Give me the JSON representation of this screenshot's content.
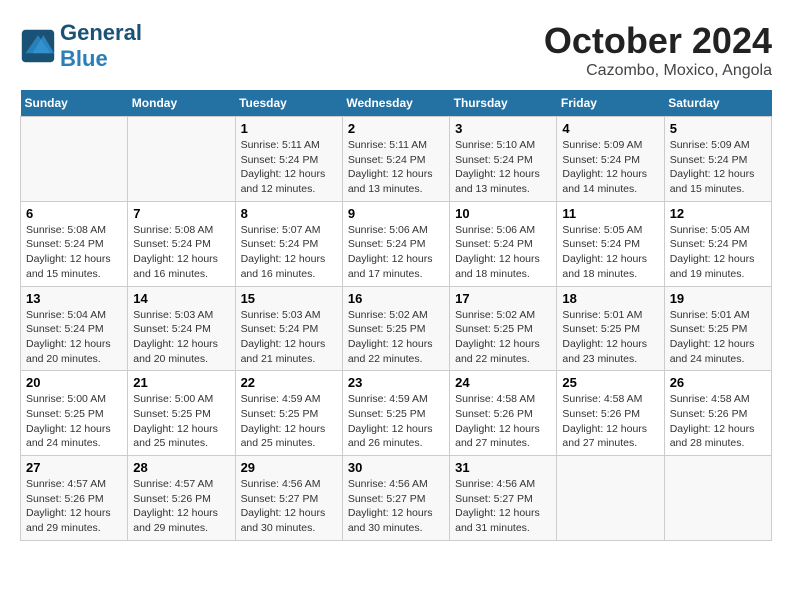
{
  "logo": {
    "general": "General",
    "blue": "Blue"
  },
  "title": "October 2024",
  "subtitle": "Cazombo, Moxico, Angola",
  "days_header": [
    "Sunday",
    "Monday",
    "Tuesday",
    "Wednesday",
    "Thursday",
    "Friday",
    "Saturday"
  ],
  "weeks": [
    [
      {
        "day": "",
        "info": ""
      },
      {
        "day": "",
        "info": ""
      },
      {
        "day": "1",
        "info": "Sunrise: 5:11 AM\nSunset: 5:24 PM\nDaylight: 12 hours\nand 12 minutes."
      },
      {
        "day": "2",
        "info": "Sunrise: 5:11 AM\nSunset: 5:24 PM\nDaylight: 12 hours\nand 13 minutes."
      },
      {
        "day": "3",
        "info": "Sunrise: 5:10 AM\nSunset: 5:24 PM\nDaylight: 12 hours\nand 13 minutes."
      },
      {
        "day": "4",
        "info": "Sunrise: 5:09 AM\nSunset: 5:24 PM\nDaylight: 12 hours\nand 14 minutes."
      },
      {
        "day": "5",
        "info": "Sunrise: 5:09 AM\nSunset: 5:24 PM\nDaylight: 12 hours\nand 15 minutes."
      }
    ],
    [
      {
        "day": "6",
        "info": "Sunrise: 5:08 AM\nSunset: 5:24 PM\nDaylight: 12 hours\nand 15 minutes."
      },
      {
        "day": "7",
        "info": "Sunrise: 5:08 AM\nSunset: 5:24 PM\nDaylight: 12 hours\nand 16 minutes."
      },
      {
        "day": "8",
        "info": "Sunrise: 5:07 AM\nSunset: 5:24 PM\nDaylight: 12 hours\nand 16 minutes."
      },
      {
        "day": "9",
        "info": "Sunrise: 5:06 AM\nSunset: 5:24 PM\nDaylight: 12 hours\nand 17 minutes."
      },
      {
        "day": "10",
        "info": "Sunrise: 5:06 AM\nSunset: 5:24 PM\nDaylight: 12 hours\nand 18 minutes."
      },
      {
        "day": "11",
        "info": "Sunrise: 5:05 AM\nSunset: 5:24 PM\nDaylight: 12 hours\nand 18 minutes."
      },
      {
        "day": "12",
        "info": "Sunrise: 5:05 AM\nSunset: 5:24 PM\nDaylight: 12 hours\nand 19 minutes."
      }
    ],
    [
      {
        "day": "13",
        "info": "Sunrise: 5:04 AM\nSunset: 5:24 PM\nDaylight: 12 hours\nand 20 minutes."
      },
      {
        "day": "14",
        "info": "Sunrise: 5:03 AM\nSunset: 5:24 PM\nDaylight: 12 hours\nand 20 minutes."
      },
      {
        "day": "15",
        "info": "Sunrise: 5:03 AM\nSunset: 5:24 PM\nDaylight: 12 hours\nand 21 minutes."
      },
      {
        "day": "16",
        "info": "Sunrise: 5:02 AM\nSunset: 5:25 PM\nDaylight: 12 hours\nand 22 minutes."
      },
      {
        "day": "17",
        "info": "Sunrise: 5:02 AM\nSunset: 5:25 PM\nDaylight: 12 hours\nand 22 minutes."
      },
      {
        "day": "18",
        "info": "Sunrise: 5:01 AM\nSunset: 5:25 PM\nDaylight: 12 hours\nand 23 minutes."
      },
      {
        "day": "19",
        "info": "Sunrise: 5:01 AM\nSunset: 5:25 PM\nDaylight: 12 hours\nand 24 minutes."
      }
    ],
    [
      {
        "day": "20",
        "info": "Sunrise: 5:00 AM\nSunset: 5:25 PM\nDaylight: 12 hours\nand 24 minutes."
      },
      {
        "day": "21",
        "info": "Sunrise: 5:00 AM\nSunset: 5:25 PM\nDaylight: 12 hours\nand 25 minutes."
      },
      {
        "day": "22",
        "info": "Sunrise: 4:59 AM\nSunset: 5:25 PM\nDaylight: 12 hours\nand 25 minutes."
      },
      {
        "day": "23",
        "info": "Sunrise: 4:59 AM\nSunset: 5:25 PM\nDaylight: 12 hours\nand 26 minutes."
      },
      {
        "day": "24",
        "info": "Sunrise: 4:58 AM\nSunset: 5:26 PM\nDaylight: 12 hours\nand 27 minutes."
      },
      {
        "day": "25",
        "info": "Sunrise: 4:58 AM\nSunset: 5:26 PM\nDaylight: 12 hours\nand 27 minutes."
      },
      {
        "day": "26",
        "info": "Sunrise: 4:58 AM\nSunset: 5:26 PM\nDaylight: 12 hours\nand 28 minutes."
      }
    ],
    [
      {
        "day": "27",
        "info": "Sunrise: 4:57 AM\nSunset: 5:26 PM\nDaylight: 12 hours\nand 29 minutes."
      },
      {
        "day": "28",
        "info": "Sunrise: 4:57 AM\nSunset: 5:26 PM\nDaylight: 12 hours\nand 29 minutes."
      },
      {
        "day": "29",
        "info": "Sunrise: 4:56 AM\nSunset: 5:27 PM\nDaylight: 12 hours\nand 30 minutes."
      },
      {
        "day": "30",
        "info": "Sunrise: 4:56 AM\nSunset: 5:27 PM\nDaylight: 12 hours\nand 30 minutes."
      },
      {
        "day": "31",
        "info": "Sunrise: 4:56 AM\nSunset: 5:27 PM\nDaylight: 12 hours\nand 31 minutes."
      },
      {
        "day": "",
        "info": ""
      },
      {
        "day": "",
        "info": ""
      }
    ]
  ]
}
